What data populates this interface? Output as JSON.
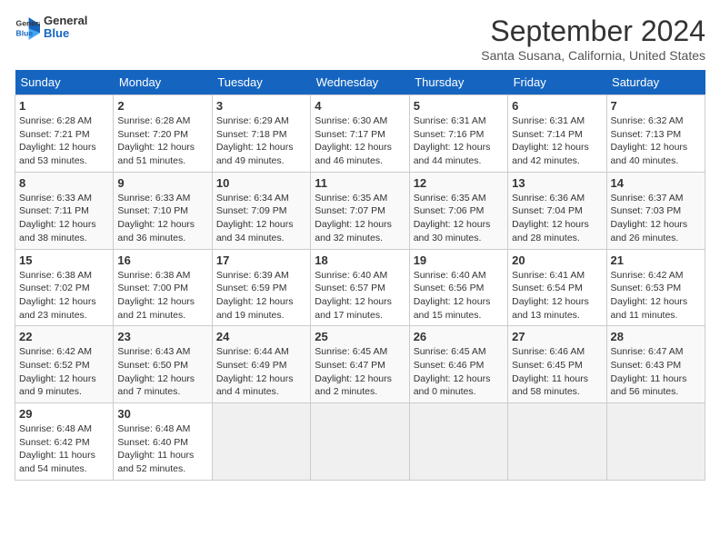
{
  "header": {
    "logo_line1": "General",
    "logo_line2": "Blue",
    "title": "September 2024",
    "subtitle": "Santa Susana, California, United States"
  },
  "columns": [
    "Sunday",
    "Monday",
    "Tuesday",
    "Wednesday",
    "Thursday",
    "Friday",
    "Saturday"
  ],
  "weeks": [
    [
      {
        "day": "1",
        "sunrise": "Sunrise: 6:28 AM",
        "sunset": "Sunset: 7:21 PM",
        "daylight": "Daylight: 12 hours and 53 minutes."
      },
      {
        "day": "2",
        "sunrise": "Sunrise: 6:28 AM",
        "sunset": "Sunset: 7:20 PM",
        "daylight": "Daylight: 12 hours and 51 minutes."
      },
      {
        "day": "3",
        "sunrise": "Sunrise: 6:29 AM",
        "sunset": "Sunset: 7:18 PM",
        "daylight": "Daylight: 12 hours and 49 minutes."
      },
      {
        "day": "4",
        "sunrise": "Sunrise: 6:30 AM",
        "sunset": "Sunset: 7:17 PM",
        "daylight": "Daylight: 12 hours and 46 minutes."
      },
      {
        "day": "5",
        "sunrise": "Sunrise: 6:31 AM",
        "sunset": "Sunset: 7:16 PM",
        "daylight": "Daylight: 12 hours and 44 minutes."
      },
      {
        "day": "6",
        "sunrise": "Sunrise: 6:31 AM",
        "sunset": "Sunset: 7:14 PM",
        "daylight": "Daylight: 12 hours and 42 minutes."
      },
      {
        "day": "7",
        "sunrise": "Sunrise: 6:32 AM",
        "sunset": "Sunset: 7:13 PM",
        "daylight": "Daylight: 12 hours and 40 minutes."
      }
    ],
    [
      {
        "day": "8",
        "sunrise": "Sunrise: 6:33 AM",
        "sunset": "Sunset: 7:11 PM",
        "daylight": "Daylight: 12 hours and 38 minutes."
      },
      {
        "day": "9",
        "sunrise": "Sunrise: 6:33 AM",
        "sunset": "Sunset: 7:10 PM",
        "daylight": "Daylight: 12 hours and 36 minutes."
      },
      {
        "day": "10",
        "sunrise": "Sunrise: 6:34 AM",
        "sunset": "Sunset: 7:09 PM",
        "daylight": "Daylight: 12 hours and 34 minutes."
      },
      {
        "day": "11",
        "sunrise": "Sunrise: 6:35 AM",
        "sunset": "Sunset: 7:07 PM",
        "daylight": "Daylight: 12 hours and 32 minutes."
      },
      {
        "day": "12",
        "sunrise": "Sunrise: 6:35 AM",
        "sunset": "Sunset: 7:06 PM",
        "daylight": "Daylight: 12 hours and 30 minutes."
      },
      {
        "day": "13",
        "sunrise": "Sunrise: 6:36 AM",
        "sunset": "Sunset: 7:04 PM",
        "daylight": "Daylight: 12 hours and 28 minutes."
      },
      {
        "day": "14",
        "sunrise": "Sunrise: 6:37 AM",
        "sunset": "Sunset: 7:03 PM",
        "daylight": "Daylight: 12 hours and 26 minutes."
      }
    ],
    [
      {
        "day": "15",
        "sunrise": "Sunrise: 6:38 AM",
        "sunset": "Sunset: 7:02 PM",
        "daylight": "Daylight: 12 hours and 23 minutes."
      },
      {
        "day": "16",
        "sunrise": "Sunrise: 6:38 AM",
        "sunset": "Sunset: 7:00 PM",
        "daylight": "Daylight: 12 hours and 21 minutes."
      },
      {
        "day": "17",
        "sunrise": "Sunrise: 6:39 AM",
        "sunset": "Sunset: 6:59 PM",
        "daylight": "Daylight: 12 hours and 19 minutes."
      },
      {
        "day": "18",
        "sunrise": "Sunrise: 6:40 AM",
        "sunset": "Sunset: 6:57 PM",
        "daylight": "Daylight: 12 hours and 17 minutes."
      },
      {
        "day": "19",
        "sunrise": "Sunrise: 6:40 AM",
        "sunset": "Sunset: 6:56 PM",
        "daylight": "Daylight: 12 hours and 15 minutes."
      },
      {
        "day": "20",
        "sunrise": "Sunrise: 6:41 AM",
        "sunset": "Sunset: 6:54 PM",
        "daylight": "Daylight: 12 hours and 13 minutes."
      },
      {
        "day": "21",
        "sunrise": "Sunrise: 6:42 AM",
        "sunset": "Sunset: 6:53 PM",
        "daylight": "Daylight: 12 hours and 11 minutes."
      }
    ],
    [
      {
        "day": "22",
        "sunrise": "Sunrise: 6:42 AM",
        "sunset": "Sunset: 6:52 PM",
        "daylight": "Daylight: 12 hours and 9 minutes."
      },
      {
        "day": "23",
        "sunrise": "Sunrise: 6:43 AM",
        "sunset": "Sunset: 6:50 PM",
        "daylight": "Daylight: 12 hours and 7 minutes."
      },
      {
        "day": "24",
        "sunrise": "Sunrise: 6:44 AM",
        "sunset": "Sunset: 6:49 PM",
        "daylight": "Daylight: 12 hours and 4 minutes."
      },
      {
        "day": "25",
        "sunrise": "Sunrise: 6:45 AM",
        "sunset": "Sunset: 6:47 PM",
        "daylight": "Daylight: 12 hours and 2 minutes."
      },
      {
        "day": "26",
        "sunrise": "Sunrise: 6:45 AM",
        "sunset": "Sunset: 6:46 PM",
        "daylight": "Daylight: 12 hours and 0 minutes."
      },
      {
        "day": "27",
        "sunrise": "Sunrise: 6:46 AM",
        "sunset": "Sunset: 6:45 PM",
        "daylight": "Daylight: 11 hours and 58 minutes."
      },
      {
        "day": "28",
        "sunrise": "Sunrise: 6:47 AM",
        "sunset": "Sunset: 6:43 PM",
        "daylight": "Daylight: 11 hours and 56 minutes."
      }
    ],
    [
      {
        "day": "29",
        "sunrise": "Sunrise: 6:48 AM",
        "sunset": "Sunset: 6:42 PM",
        "daylight": "Daylight: 11 hours and 54 minutes."
      },
      {
        "day": "30",
        "sunrise": "Sunrise: 6:48 AM",
        "sunset": "Sunset: 6:40 PM",
        "daylight": "Daylight: 11 hours and 52 minutes."
      },
      null,
      null,
      null,
      null,
      null
    ]
  ]
}
